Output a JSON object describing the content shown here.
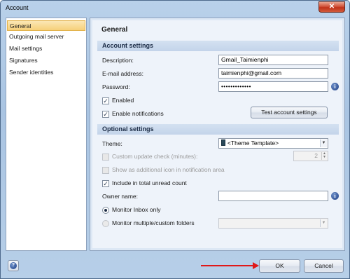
{
  "window": {
    "title": "Account",
    "close_glyph": "✕"
  },
  "sidebar": {
    "items": [
      {
        "label": "General"
      },
      {
        "label": "Outgoing mail server"
      },
      {
        "label": "Mail settings"
      },
      {
        "label": "Signatures"
      },
      {
        "label": "Sender identities"
      }
    ],
    "selected": "General"
  },
  "main": {
    "title": "General",
    "account_settings": {
      "header": "Account settings",
      "description_label": "Description:",
      "description_value": "Gmail_Taimienphi",
      "email_label": "E-mail address:",
      "email_value": "taimienphi@gmail.com",
      "password_label": "Password:",
      "password_value": "•••••••••••••",
      "enabled_label": "Enabled",
      "enabled_checked": true,
      "notifications_label": "Enable notifications",
      "notifications_checked": true,
      "test_button": "Test account settings"
    },
    "optional_settings": {
      "header": "Optional settings",
      "theme_label": "Theme:",
      "theme_value": "<Theme Template>",
      "custom_check_label": "Custom update check (minutes):",
      "custom_check_value": "2",
      "show_icon_label": "Show as additional icon in notification area",
      "include_unread_label": "Include in total unread count",
      "include_unread_checked": true,
      "owner_label": "Owner name:",
      "owner_value": "",
      "monitor_inbox_label": "Monitor Inbox only",
      "monitor_custom_label": "Monitor multiple/custom folders",
      "monitor_selected": "Monitor Inbox only"
    }
  },
  "footer": {
    "help_glyph": "?",
    "ok_label": "OK",
    "cancel_label": "Cancel"
  },
  "icons": {
    "info": "i",
    "check": "✓",
    "dropdown": "▼",
    "spin_up": "▲",
    "spin_down": "▼"
  },
  "colors": {
    "selection": "#f6d07a",
    "annotation_arrow": "#e01818"
  }
}
